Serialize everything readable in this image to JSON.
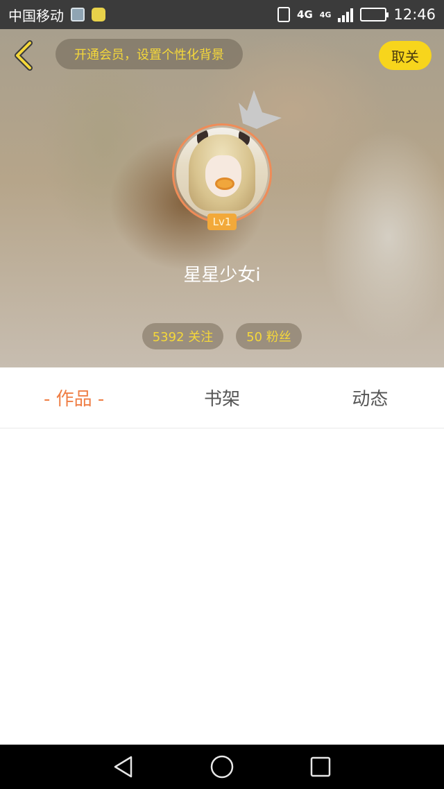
{
  "status_bar": {
    "carrier": "中国移动",
    "network": "4G",
    "network_small": "4G",
    "time": "12:46"
  },
  "header": {
    "vip_banner": "开通会员，设置个性化背景",
    "unfollow_label": "取关"
  },
  "profile": {
    "level": "Lv1",
    "username": "星星少女i",
    "following": "5392 关注",
    "followers": "50 粉丝"
  },
  "tabs": [
    {
      "label": "- 作品 -",
      "active": true
    },
    {
      "label": "书架",
      "active": false
    },
    {
      "label": "动态",
      "active": false
    }
  ],
  "colors": {
    "accent_yellow": "#f5d83a",
    "active_tab": "#ef7e45",
    "avatar_ring": "#ef8c58",
    "level_badge": "#f2a93a"
  },
  "icons": {
    "back": "chevron-left-icon",
    "crown": "crown-icon",
    "nav_back": "triangle-back-icon",
    "nav_home": "circle-home-icon",
    "nav_recent": "square-recent-icon"
  }
}
